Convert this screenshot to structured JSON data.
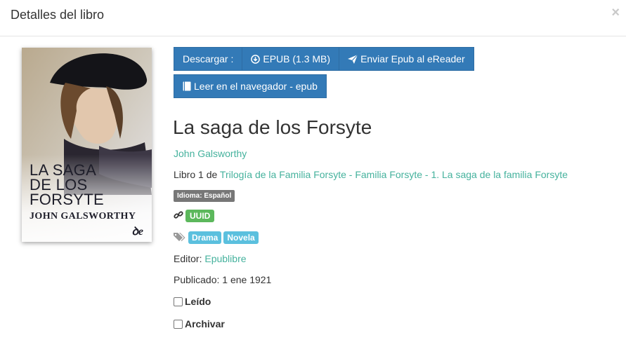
{
  "modal": {
    "title": "Detalles del libro",
    "close_label": "×"
  },
  "cover": {
    "title_lines": [
      "LA SAGA",
      "DE LOS",
      "FORSYTE"
    ],
    "author": "JOHN GALSWORTHY",
    "logo": "ꝺe"
  },
  "toolbar": {
    "download_label": "Descargar :",
    "epub_label": "EPUB (1.3 MB)",
    "send_label": "Enviar Epub al eReader",
    "read_label": "Leer en el navegador - epub"
  },
  "book": {
    "title": "La saga de los Forsyte",
    "author": "John Galsworthy",
    "series_prefix": "Libro 1 de ",
    "series": "Trilogía de la Familia Forsyte - Familia Forsyte - 1. La saga de la familia Forsyte",
    "language_badge": "Idioma: Español",
    "uuid_badge": "UUID",
    "tags": [
      "Drama",
      "Novela"
    ],
    "publisher_label": "Editor: ",
    "publisher": "Epublibre",
    "published": "Publicado: 1 ene 1921"
  },
  "checkboxes": {
    "read_label": "Leído",
    "archive_label": "Archivar"
  },
  "colors": {
    "primary": "#337ab7",
    "link": "#45b29d",
    "success": "#5cb85c",
    "info": "#5bc0de",
    "default": "#777777"
  },
  "icons": {
    "download": "download-circle-icon",
    "send": "paper-plane-icon",
    "read": "book-icon",
    "uuid": "link-icon",
    "tags": "tags-icon"
  }
}
